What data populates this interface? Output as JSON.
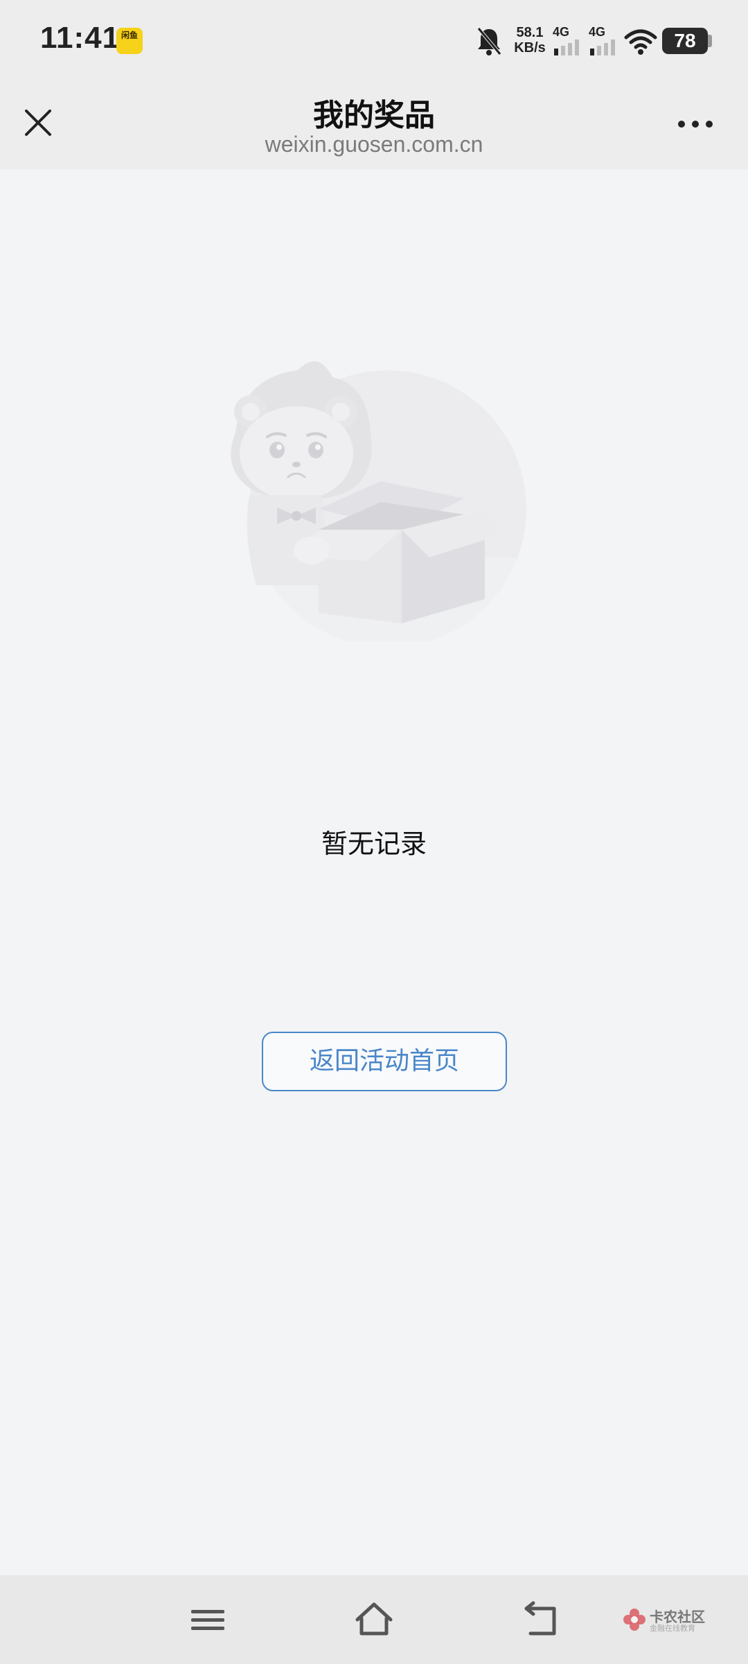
{
  "status_bar": {
    "time": "11:41",
    "app_badge": "闲鱼",
    "net_speed_value": "58.1",
    "net_speed_unit": "KB/s",
    "signal1_label": "4G",
    "signal2_label": "4G",
    "battery": "78",
    "icons": [
      "mute-bell-icon",
      "signal-icon",
      "signal-icon",
      "wifi-icon",
      "battery-icon"
    ]
  },
  "nav": {
    "title": "我的奖品",
    "subtitle": "weixin.guosen.com.cn",
    "close_icon": "close-icon",
    "more_icon": "more-dots-icon"
  },
  "main": {
    "empty_text": "暂无记录",
    "return_button": "返回活动首页",
    "illustration": "lion-with-empty-box"
  },
  "bottom_bar": {
    "icons": [
      "menu-icon",
      "home-icon",
      "back-icon"
    ],
    "watermark_text": "卡农社区",
    "watermark_sub": "金融在线教育"
  },
  "colors": {
    "page_bg": "#f3f4f6",
    "header_bg": "#ededed",
    "accent": "#4a86c8"
  }
}
